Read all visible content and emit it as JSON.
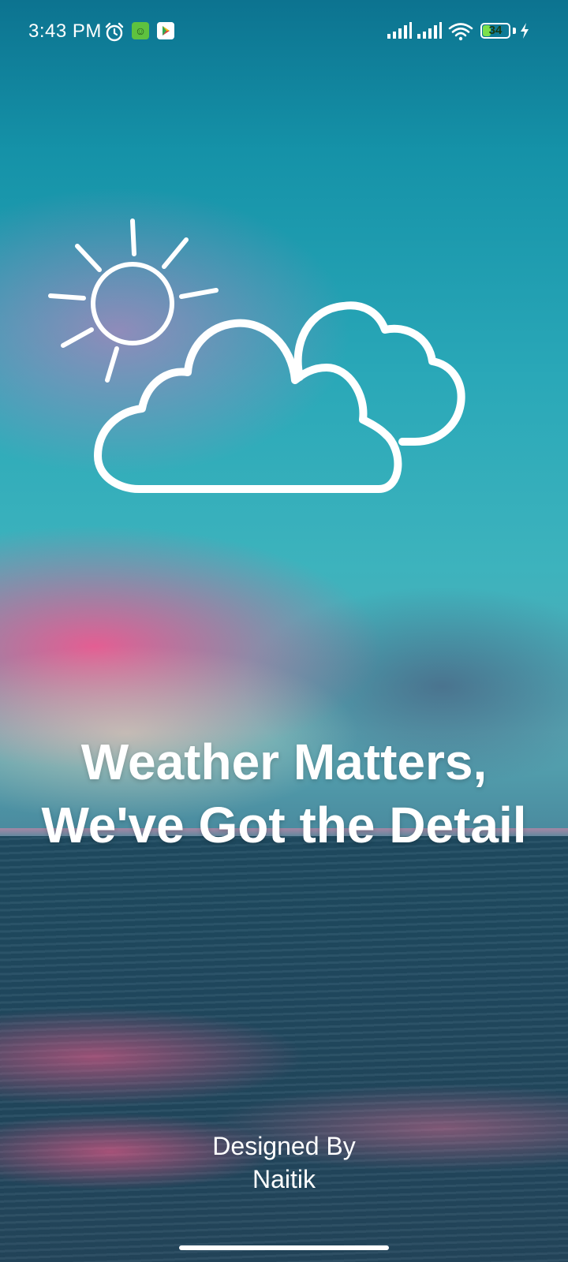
{
  "status_bar": {
    "time": "3:43 PM",
    "battery_level": "34",
    "battery_fraction": 0.34,
    "charging": true,
    "icons": [
      "alarm-icon",
      "app-notification-icon",
      "play-store-icon",
      "signal-icon",
      "signal-icon",
      "wifi-icon",
      "battery-icon",
      "charging-bolt-icon"
    ]
  },
  "splash": {
    "illustration": "sun-behind-clouds-icon",
    "headline_line1": "Weather Matters,",
    "headline_line2": "We've Got the Detail",
    "credit_line1": "Designed By",
    "credit_line2": "Naitik"
  },
  "colors": {
    "text": "#ffffff",
    "sky_top": "#0c7390",
    "sky_pink": "#ff508c",
    "sea": "#1f5369"
  }
}
